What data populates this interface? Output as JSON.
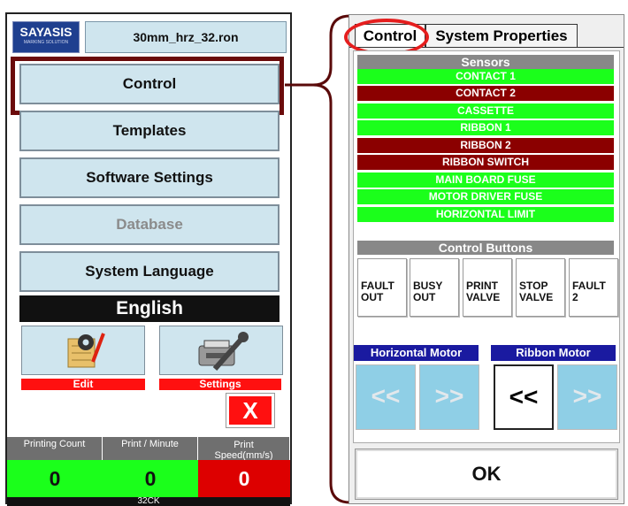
{
  "header": {
    "logo_text": "SAYASIS",
    "logo_tagline": "MARKING SOLUTION",
    "filename": "30mm_hrz_32.ron"
  },
  "menu": {
    "items": [
      {
        "label": "Control",
        "enabled": true,
        "selected": true
      },
      {
        "label": "Templates",
        "enabled": true
      },
      {
        "label": "Software Settings",
        "enabled": true
      },
      {
        "label": "Database",
        "enabled": false
      },
      {
        "label": "System Language",
        "enabled": true
      }
    ],
    "language_value": "English"
  },
  "actions": {
    "edit_label": "Edit",
    "settings_label": "Settings",
    "close_label": "X"
  },
  "stats": [
    {
      "label": "Printing Count",
      "value": "0"
    },
    {
      "label": "Print / Minute",
      "value": "0"
    },
    {
      "label": "Print Speed(mm/s)",
      "value": "0"
    }
  ],
  "footer_text": "32CK",
  "tabs": [
    {
      "label": "Control",
      "active": true
    },
    {
      "label": "System Properties",
      "active": false
    }
  ],
  "sensors": {
    "title": "Sensors",
    "items": [
      {
        "label": "CONTACT 1",
        "state": "ok"
      },
      {
        "label": "CONTACT 2",
        "state": "fault"
      },
      {
        "label": "CASSETTE",
        "state": "ok"
      },
      {
        "label": "RIBBON 1",
        "state": "ok"
      },
      {
        "label": "RIBBON 2",
        "state": "fault"
      },
      {
        "label": "RIBBON SWITCH",
        "state": "fault"
      },
      {
        "label": "MAIN BOARD FUSE",
        "state": "ok"
      },
      {
        "label": "MOTOR DRIVER FUSE",
        "state": "ok"
      },
      {
        "label": "HORIZONTAL LIMIT",
        "state": "ok"
      }
    ]
  },
  "control_buttons": {
    "title": "Control Buttons",
    "items": [
      "FAULT\nOUT",
      "BUSY\nOUT",
      "PRINT\nVALVE",
      "STOP\nVALVE",
      "FAULT\n2"
    ]
  },
  "horizontal_motor": {
    "title": "Horizontal Motor",
    "left": "<<",
    "right": ">>"
  },
  "ribbon_motor": {
    "title": "Ribbon Motor",
    "left": "<<",
    "right": ">>"
  },
  "ok_label": "OK",
  "colors": {
    "sensor_ok": "#1bff1b",
    "sensor_fault": "#8b0000",
    "highlight": "#6b0b0b",
    "circle": "#e51e1e"
  }
}
